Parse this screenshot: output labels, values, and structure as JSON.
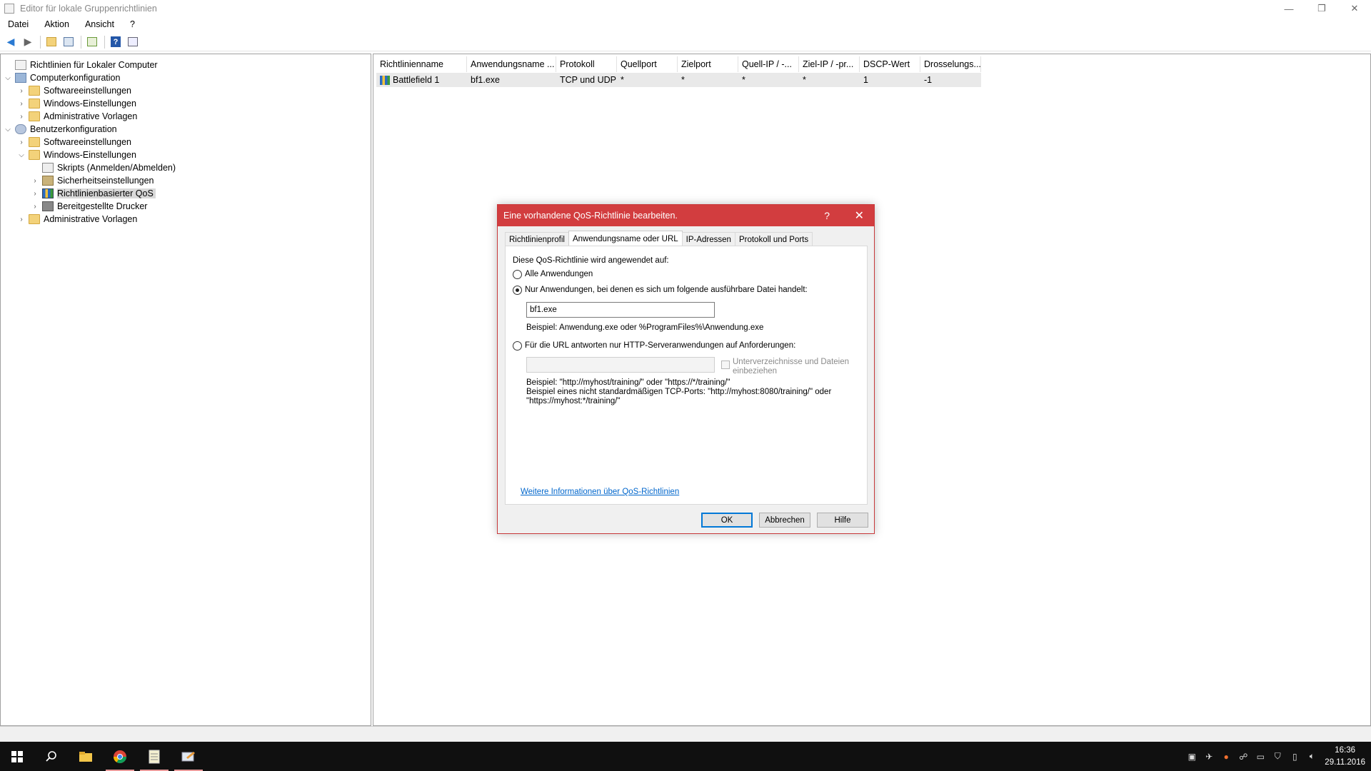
{
  "window": {
    "title": "Editor für lokale Gruppenrichtlinien",
    "controls": [
      "—",
      "❐",
      "✕"
    ]
  },
  "menu": [
    "Datei",
    "Aktion",
    "Ansicht",
    "?"
  ],
  "tree": [
    {
      "label": "Richtlinien für Lokaler Computer",
      "level": 0,
      "chev": "",
      "icon": "policy"
    },
    {
      "label": "Computerkonfiguration",
      "level": 0,
      "chev": "open",
      "icon": "comp"
    },
    {
      "label": "Softwareeinstellungen",
      "level": 1,
      "chev": "closed",
      "icon": "folder"
    },
    {
      "label": "Windows-Einstellungen",
      "level": 1,
      "chev": "closed",
      "icon": "folder"
    },
    {
      "label": "Administrative Vorlagen",
      "level": 1,
      "chev": "closed",
      "icon": "folder"
    },
    {
      "label": "Benutzerkonfiguration",
      "level": 0,
      "chev": "open",
      "icon": "user"
    },
    {
      "label": "Softwareeinstellungen",
      "level": 1,
      "chev": "closed",
      "icon": "folder"
    },
    {
      "label": "Windows-Einstellungen",
      "level": 1,
      "chev": "open",
      "icon": "folder"
    },
    {
      "label": "Skripts (Anmelden/Abmelden)",
      "level": 2,
      "chev": "",
      "icon": "script"
    },
    {
      "label": "Sicherheitseinstellungen",
      "level": 2,
      "chev": "closed",
      "icon": "lock"
    },
    {
      "label": "Richtlinienbasierter QoS",
      "level": 2,
      "chev": "closed",
      "icon": "qos",
      "selected": true
    },
    {
      "label": "Bereitgestellte Drucker",
      "level": 2,
      "chev": "closed",
      "icon": "printer"
    },
    {
      "label": "Administrative Vorlagen",
      "level": 1,
      "chev": "closed",
      "icon": "folder"
    }
  ],
  "list": {
    "columns": [
      "Richtlinienname",
      "Anwendungsname ...",
      "Protokoll",
      "Quellport",
      "Zielport",
      "Quell-IP / -...",
      "Ziel-IP / -pr...",
      "DSCP-Wert",
      "Drosselungs..."
    ],
    "rows": [
      [
        "Battlefield 1",
        "bf1.exe",
        "TCP und UDP",
        "*",
        "*",
        "*",
        "*",
        "1",
        "-1"
      ]
    ]
  },
  "dialog": {
    "title": "Eine vorhandene QoS-Richtlinie bearbeiten.",
    "help": "?",
    "close": "✕",
    "tabs": [
      "Richtlinienprofil",
      "Anwendungsname oder URL",
      "IP-Adressen",
      "Protokoll und Ports"
    ],
    "active_tab": 1,
    "applies_label": "Diese QoS-Richtlinie wird angewendet auf:",
    "radio_all": "Alle Anwendungen",
    "radio_exe": "Nur Anwendungen, bei denen es sich um folgende ausführbare Datei handelt:",
    "exe_value": "bf1.exe",
    "exe_example": "Beispiel:  Anwendung.exe oder  %ProgramFiles%\\Anwendung.exe",
    "radio_url": "Für die URL antworten nur HTTP-Serveranwendungen auf Anforderungen:",
    "url_value": "",
    "include_sub_line1": "Unterverzeichnisse und Dateien",
    "include_sub_line2": "einbeziehen",
    "url_example1": "Beispiel: \"http://myhost/training/\" oder \"https://*/training/\"",
    "url_example2": "Beispiel eines nicht standardmäßigen TCP-Ports:  \"http://myhost:8080/training/\" oder",
    "url_example3": "\"https://myhost:*/training/\"",
    "more_info_link": "Weitere Informationen über QoS-Richtlinien",
    "selected_radio": "exe",
    "buttons": {
      "ok": "OK",
      "cancel": "Abbrechen",
      "help": "Hilfe"
    }
  },
  "taskbar": {
    "time": "16:36",
    "date": "29.11.2016"
  }
}
